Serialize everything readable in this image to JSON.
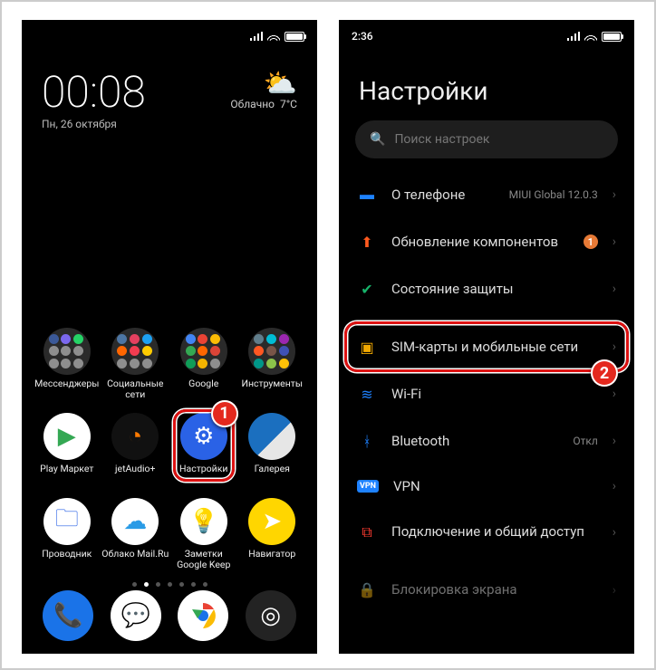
{
  "home": {
    "status": {
      "time_left": "",
      "right_icons": [
        "wifi",
        "signal",
        "battery"
      ]
    },
    "clock": {
      "time": "00:08",
      "date": "Пн, 26 октября"
    },
    "weather": {
      "text_top": "Облачно",
      "text_side": "7°C",
      "icon": "⛅"
    },
    "folders": [
      {
        "name": "Мессенджеры",
        "colors": [
          "#3b5998",
          "#7b68ee",
          "#25D366",
          "#8e8e8e",
          "#8e8e8e",
          "#8e8e8e",
          "#8e8e8e",
          "#8e8e8e",
          "#8e8e8e"
        ]
      },
      {
        "name": "Социальные сети",
        "colors": [
          "#4c75a3",
          "#e4405f",
          "#1da1f2",
          "#ff6600",
          "#f23c50",
          "#ffcc00",
          "#8e8e8e",
          "#8e8e8e",
          "#8e8e8e"
        ]
      },
      {
        "name": "Google",
        "colors": [
          "#4285f4",
          "#ea4335",
          "#fbbc05",
          "#34a853",
          "#ff6600",
          "#db4437",
          "#0f9d58",
          "#f4b400",
          "#8e8e8e"
        ]
      },
      {
        "name": "Инструменты",
        "colors": [
          "#607d8b",
          "#00bcd4",
          "#9c27b0",
          "#ff5722",
          "#795548",
          "#3f51b5",
          "#009688",
          "#8bc34a",
          "#ffc107"
        ]
      }
    ],
    "apps": [
      {
        "name": "Play Маркет",
        "bg": "#fff",
        "glyph": "▶",
        "fg": "#34a853"
      },
      {
        "name": "jetAudio+",
        "bg": "#111",
        "glyph": "◔",
        "fg": "#ff7a00"
      },
      {
        "name": "Настройки",
        "bg": "#2a62e6",
        "glyph": "⚙",
        "fg": "#fff",
        "hl": true
      },
      {
        "name": "Галерея",
        "bg": "linear-gradient(135deg,#1b6fbf 0%,#1b6fbf 55%,#e6e6e6 55%)",
        "glyph": "",
        "fg": "#fff"
      },
      {
        "name": "Проводник",
        "bg": "#fff",
        "glyph": "🗀",
        "fg": "#2a62e6"
      },
      {
        "name": "Облако Mail.Ru",
        "bg": "#fff",
        "glyph": "☁",
        "fg": "#2a9be6"
      },
      {
        "name": "Заметки Google Keep",
        "bg": "#fff",
        "glyph": "💡",
        "fg": "#f9a825"
      },
      {
        "name": "Навигатор",
        "bg": "#ffd600",
        "glyph": "➤",
        "fg": "#fff"
      }
    ],
    "dock": [
      {
        "name": "phone",
        "bg": "#1a73e8",
        "glyph": "📞"
      },
      {
        "name": "messages",
        "bg": "#fff",
        "glyph": "💬"
      },
      {
        "name": "chrome",
        "bg": "#fff",
        "glyph": "◉"
      },
      {
        "name": "camera",
        "bg": "#232323",
        "glyph": "◎"
      }
    ],
    "page_dots": {
      "count": 7,
      "active": 1
    },
    "marker": {
      "num": "1"
    }
  },
  "settings": {
    "status": {
      "time": "2:36"
    },
    "title": "Настройки",
    "search_placeholder": "Поиск настроек",
    "rows": [
      {
        "id": "about",
        "icon_color": "#1e82ff",
        "glyph": "▬",
        "label": "О телефоне",
        "meta": "MIUI Global 12.0.3"
      },
      {
        "id": "update",
        "icon_color": "#ff5a1f",
        "glyph": "⬆",
        "label": "Обновление компонентов",
        "badge": "1"
      },
      {
        "id": "security",
        "icon_color": "#17b36a",
        "glyph": "✔",
        "label": "Состояние защиты"
      },
      {
        "sep": true
      },
      {
        "id": "sim",
        "icon_color": "#f2a900",
        "glyph": "▣",
        "label": "SIM-карты и мобильные сети",
        "hl": true
      },
      {
        "id": "wifi",
        "icon_color": "#1e82ff",
        "glyph": "≋",
        "label": "Wi-Fi",
        "meta": " "
      },
      {
        "id": "bt",
        "icon_color": "#1e82ff",
        "glyph": "ᚼ",
        "label": "Bluetooth",
        "meta": "Откл"
      },
      {
        "id": "vpn",
        "icon_color": "#1e82ff",
        "glyph": "VPN",
        "label": "VPN",
        "small": true
      },
      {
        "id": "hotspot",
        "icon_color": "#ff3b30",
        "glyph": "⧉",
        "label": "Подключение и общий доступ"
      },
      {
        "sep": true
      },
      {
        "id": "lock",
        "icon_color": "#17b36a",
        "glyph": "🔒",
        "label": "Блокировка экрана",
        "cut": true
      }
    ],
    "marker": {
      "num": "2"
    }
  }
}
